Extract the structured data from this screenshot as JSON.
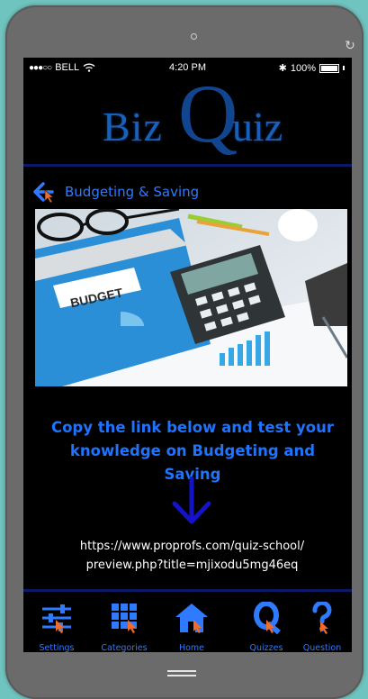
{
  "status_bar": {
    "carrier": "BELL",
    "time": "4:20 PM",
    "battery": "100%"
  },
  "logo": {
    "part1": "Biz",
    "part2": "Q",
    "part3": "uiz"
  },
  "header": {
    "back_label": "Budgeting & Saving"
  },
  "image": {
    "tag": "BUDGET"
  },
  "content": {
    "headline": "Copy the link below and test your knowledge on Budgeting and Saving",
    "link_line1": "https://www.proprofs.com/quiz-school/",
    "link_line2": "preview.php?title=mjixodu5mg46eq"
  },
  "tabs": [
    {
      "label": "Settings",
      "icon": "settings-sliders-icon"
    },
    {
      "label": "Categories",
      "icon": "grid-icon"
    },
    {
      "label": "Home",
      "icon": "home-icon"
    },
    {
      "label": "Quizzes",
      "icon": "quiz-q-icon"
    },
    {
      "label": "Question",
      "icon": "question-mark-icon"
    }
  ],
  "colors": {
    "accent": "#2e7bff",
    "cursor": "#f26b2a",
    "background": "#000000"
  }
}
